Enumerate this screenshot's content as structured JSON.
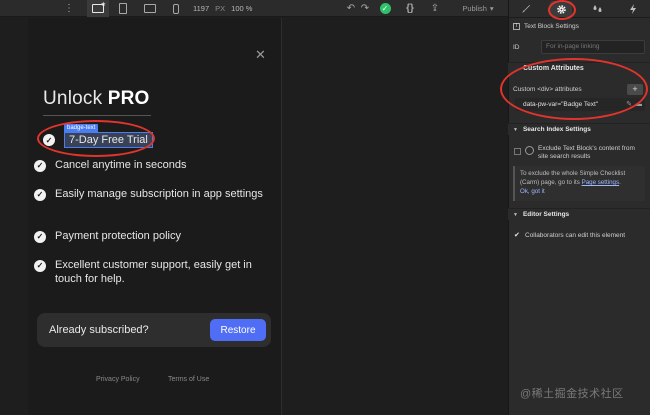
{
  "toolbar": {
    "dots": "⋮",
    "width_value": "1197",
    "width_unit": "PX",
    "zoom": "100 %",
    "undo": "↶",
    "redo": "↷",
    "status": "✓",
    "code": "{}",
    "export": "⇪",
    "publish_label": "Publish",
    "publish_caret": "▾"
  },
  "modal": {
    "close": "✕",
    "title_prefix": "Unlock",
    "title_bold": "PRO",
    "badge_tag": "badge-text",
    "check_glyph": "✓",
    "features": [
      "7-Day Free Trial",
      "Cancel anytime in seconds",
      "Easily manage subscription in app settings",
      "Payment protection policy",
      "Excellent customer support, easily get in touch for help."
    ],
    "subscribed_label": "Already subscribed?",
    "restore_label": "Restore",
    "privacy": "Privacy Policy",
    "terms": "Terms of Use"
  },
  "panel": {
    "tabs": [
      "brush-icon",
      "gear-icon",
      "drops-icon",
      "lightning-icon"
    ],
    "settings_title": "Text Block Settings",
    "id_label": "ID",
    "id_placeholder": "For in-page linking",
    "custom_attributes_heading": "Custom Attributes",
    "custom_attr_label": "Custom <div> attributes",
    "attr_value": "data-pw-var=\"Badge Text\"",
    "search_heading": "Search Index Settings",
    "exclude_text": "Exclude Text Block's content from site search results",
    "info_text": "To exclude the whole Simple Checklist (Carm) page, go to its",
    "info_link": "Page settings",
    "info_ok": "Ok, got it",
    "editor_heading": "Editor Settings",
    "collab_text": "Collaborators can edit this element"
  },
  "watermark": "@稀土掘金技术社区",
  "colors": {
    "accent": "#4f6df5",
    "selection": "#4a7cf2",
    "annotation": "#e0342c",
    "status_green": "#2ec26b",
    "background": "#1e1e1e"
  }
}
